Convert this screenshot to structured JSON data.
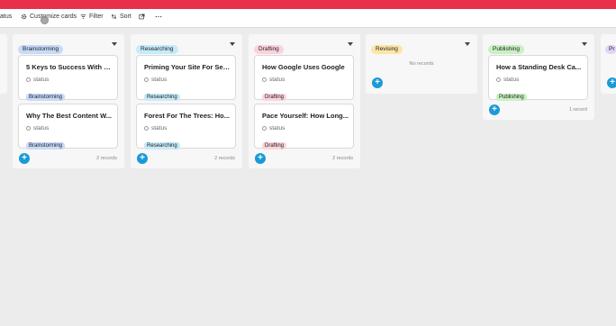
{
  "toolbar": {
    "status_partial": "atus",
    "customize": "Customize cards",
    "filter": "Filter",
    "sort": "Sort"
  },
  "columns": [
    {
      "name": "Brainstorming",
      "color": "#c7dbf9",
      "cards": [
        {
          "title": "5 Keys to Success With S...",
          "field": "status",
          "tag": "Brainstorming"
        },
        {
          "title": "Why The Best Content W...",
          "field": "status",
          "tag": "Brainstorming"
        }
      ],
      "count": "2 records"
    },
    {
      "name": "Researching",
      "color": "#c6ebf9",
      "cards": [
        {
          "title": "Priming Your Site For Sea...",
          "field": "status",
          "tag": "Researching"
        },
        {
          "title": "Forest For The Trees: Ho...",
          "field": "status",
          "tag": "Researching"
        }
      ],
      "count": "2 records"
    },
    {
      "name": "Drafting",
      "color": "#fbd3dc",
      "cards": [
        {
          "title": "How Google Uses Google",
          "field": "status",
          "tag": "Drafting"
        },
        {
          "title": "Pace Yourself: How Long...",
          "field": "status",
          "tag": "Drafting"
        }
      ],
      "count": "2 records"
    },
    {
      "name": "Revising",
      "color": "#fde6a5",
      "empty_text": "No records"
    },
    {
      "name": "Publishing",
      "color": "#c9f0c2",
      "cards": [
        {
          "title": "How a Standing Desk Ca...",
          "field": "status",
          "tag": "Publishing"
        }
      ],
      "count": "1 record"
    },
    {
      "name": "Pr",
      "color": "#e3d5f7"
    }
  ]
}
